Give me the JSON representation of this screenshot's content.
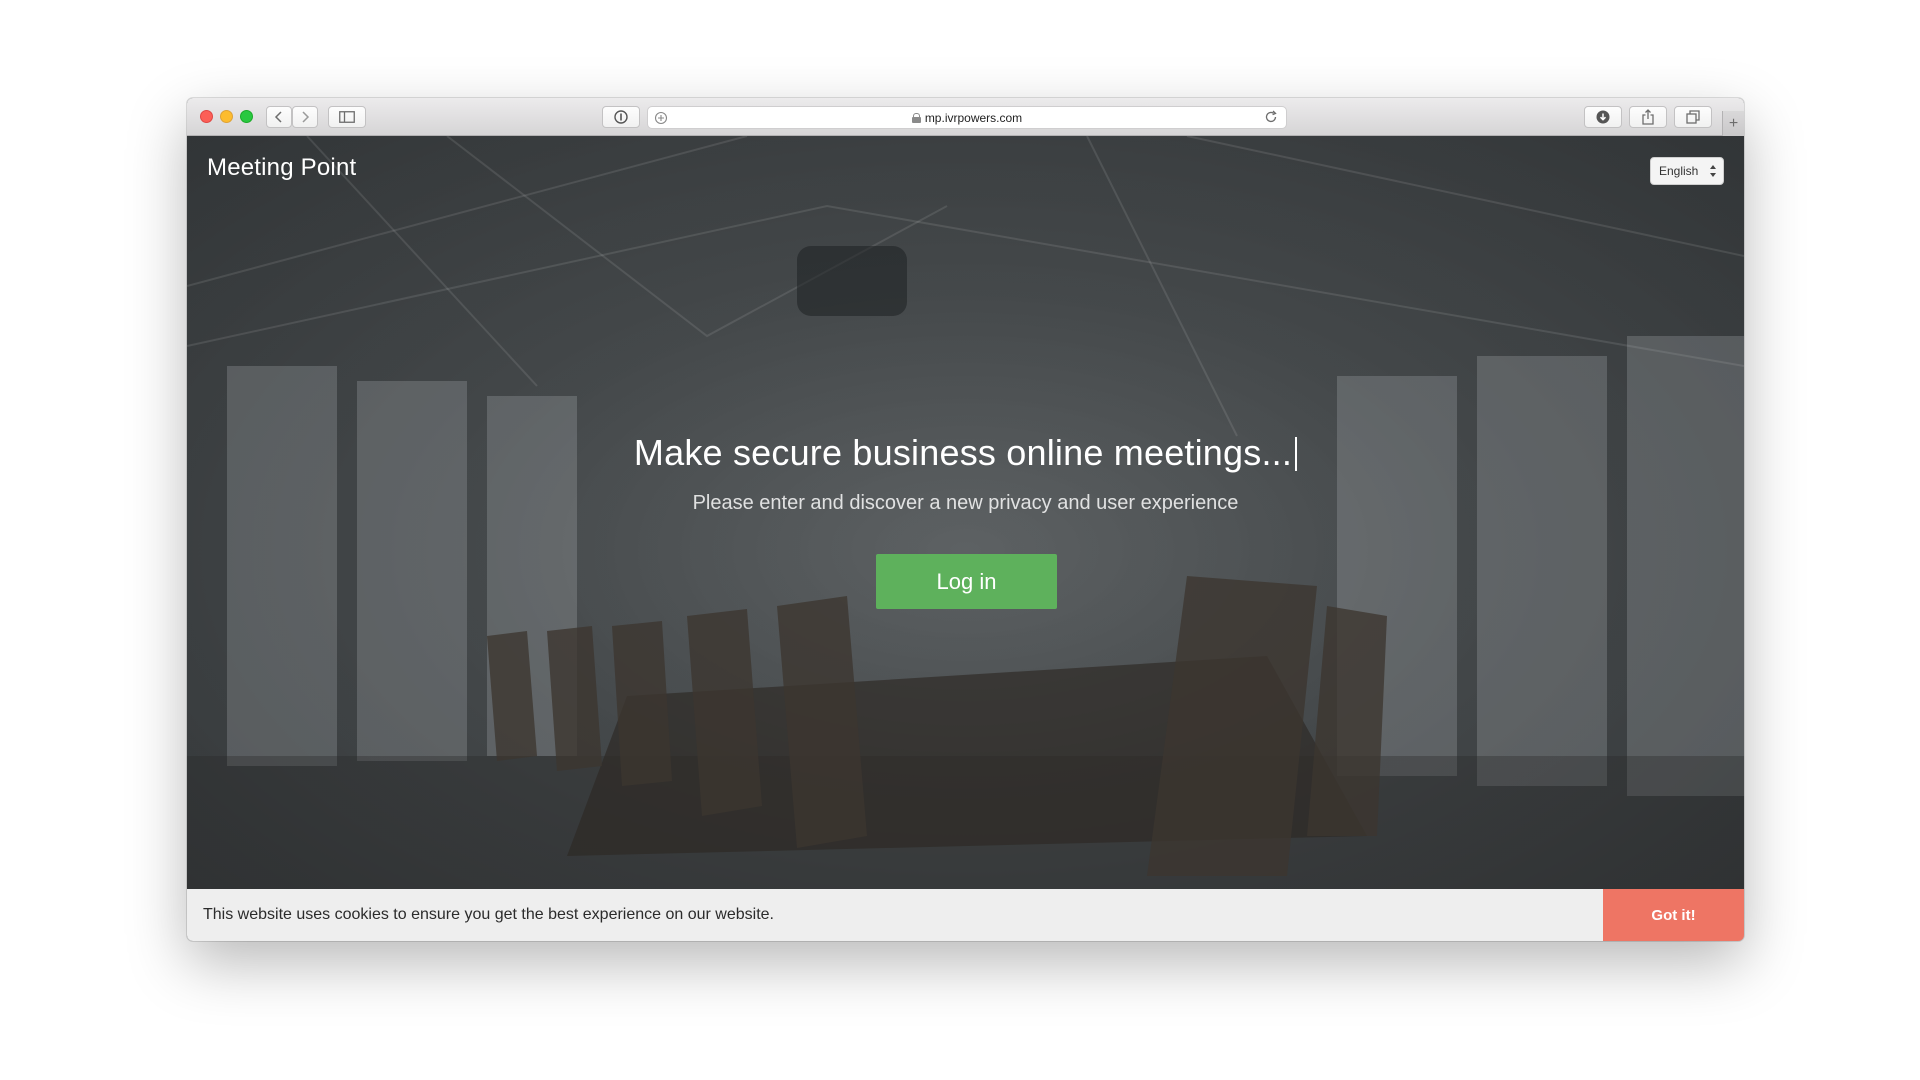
{
  "browser": {
    "url": "mp.ivrpowers.com",
    "new_tab_glyph": "+"
  },
  "header": {
    "brand": "Meeting Point",
    "language": "English"
  },
  "hero": {
    "headline": "Make secure business online meetings...",
    "subline": "Please enter and discover a new privacy and user experience",
    "login_label": "Log in"
  },
  "cookie": {
    "message": "This website uses cookies to ensure you get the best experience on our website.",
    "accept_label": "Got it!"
  },
  "colors": {
    "login_button": "#5eb15c",
    "cookie_button": "#ee7564",
    "cookie_bar": "#eeeeee"
  }
}
